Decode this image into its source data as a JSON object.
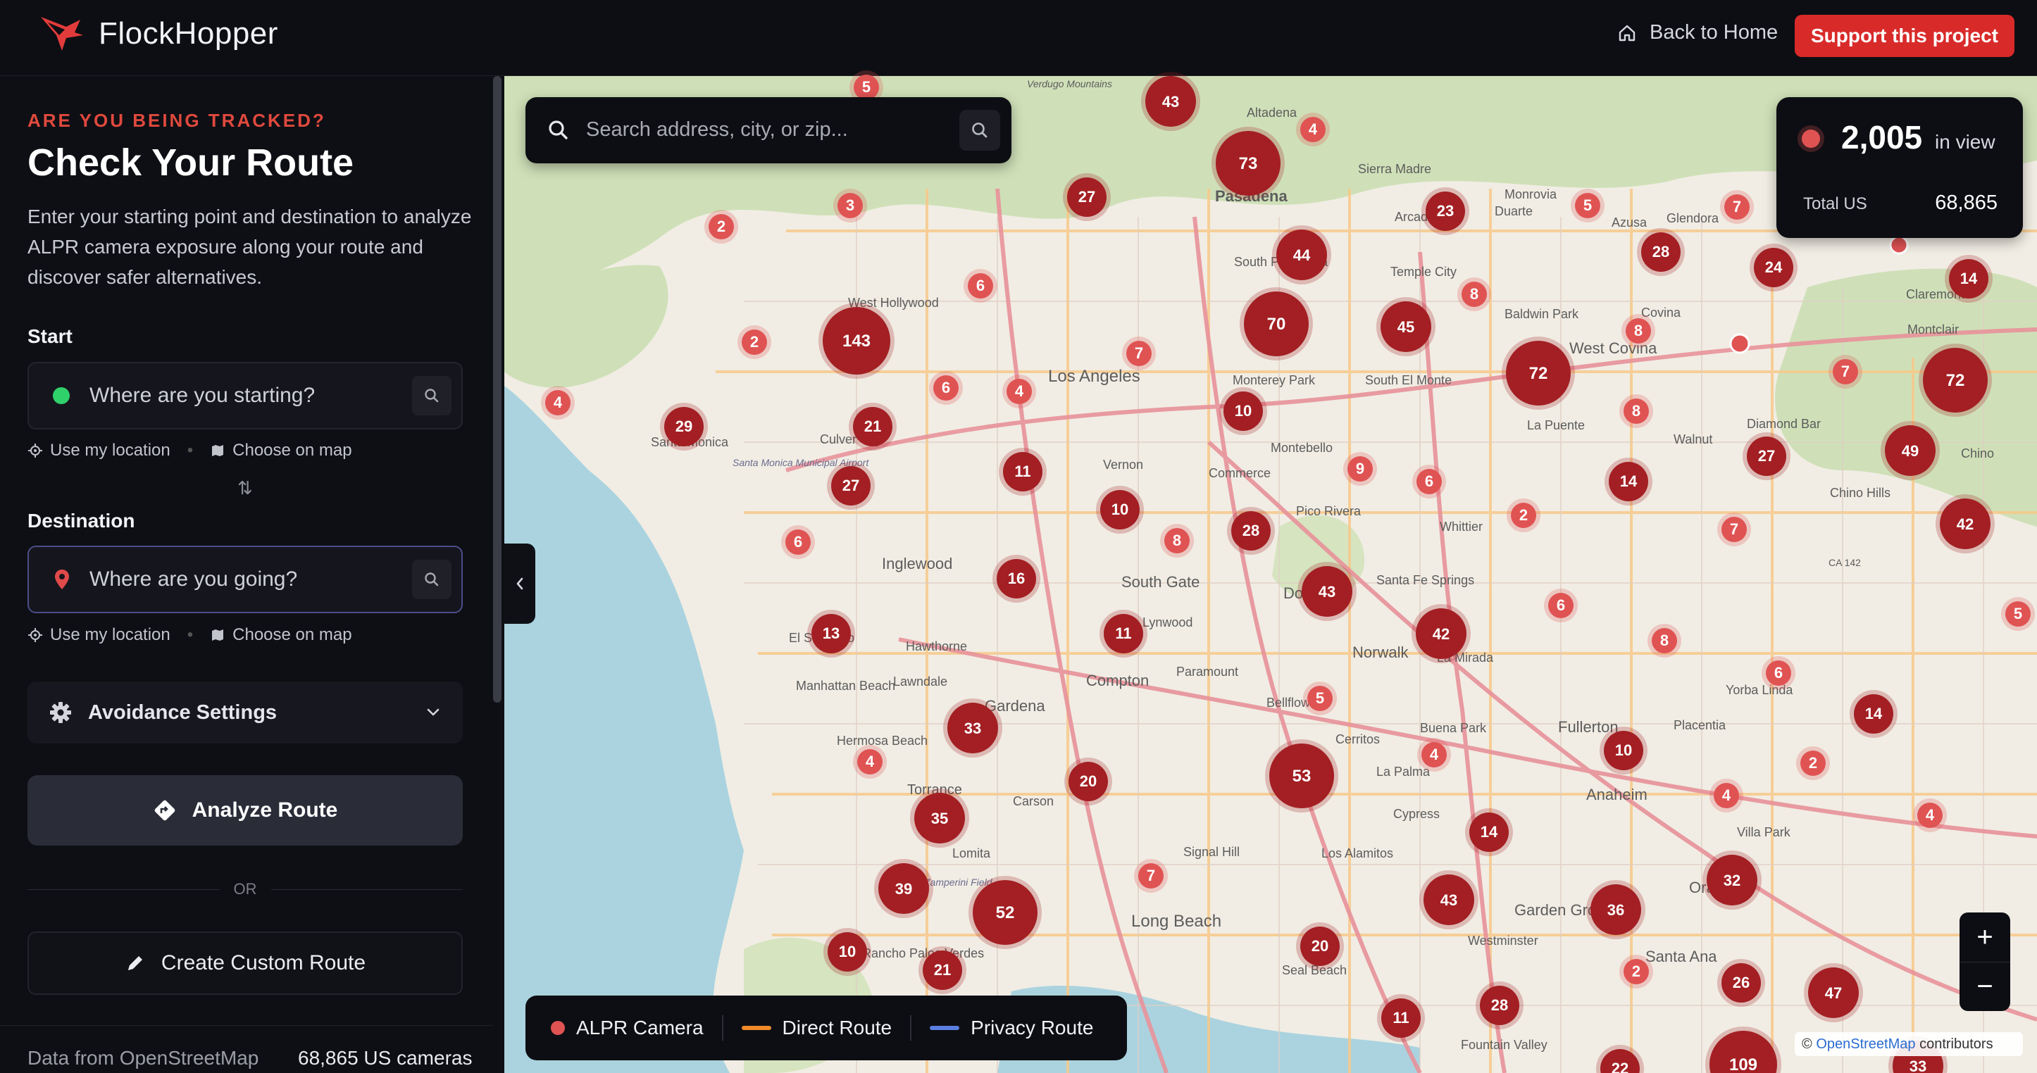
{
  "header": {
    "brand": "FlockHopper",
    "back_home": "Back to Home",
    "support": "Support this project"
  },
  "sidebar": {
    "eyebrow": "ARE YOU BEING TRACKED?",
    "title": "Check Your Route",
    "description": "Enter your starting point and destination to analyze ALPR camera exposure along your route and discover safer alternatives.",
    "start": {
      "label": "Start",
      "placeholder": "Where are you starting?",
      "use_location": "Use my location",
      "choose_map": "Choose on map"
    },
    "destination": {
      "label": "Destination",
      "placeholder": "Where are you going?",
      "use_location": "Use my location",
      "choose_map": "Choose on map"
    },
    "settings_label": "Avoidance Settings",
    "analyze_label": "Analyze Route",
    "or_label": "OR",
    "custom_label": "Create Custom Route",
    "footer": {
      "source": "Data from OpenStreetMap",
      "count": "68,865 US cameras"
    }
  },
  "map": {
    "search_placeholder": "Search address, city, or zip...",
    "stats": {
      "in_view_count": "2,005",
      "in_view_label": "in view",
      "total_label": "Total US",
      "total_value": "68,865"
    },
    "legend": {
      "camera": "ALPR Camera",
      "direct": "Direct Route",
      "privacy": "Privacy Route"
    },
    "colors": {
      "camera": "#e05353",
      "direct": "#f08a2a",
      "privacy": "#5b7fe0",
      "cluster": "#a31f23"
    },
    "zoom_in": "+",
    "zoom_out": "−",
    "attribution_prefix": "©",
    "attribution_link": "OpenStreetMap",
    "attribution_suffix": "contributors",
    "place_labels": [
      "Altadena",
      "Sierra Madre",
      "Pasadena",
      "Arcadia",
      "Duarte",
      "Azusa",
      "Glendora",
      "Monrovia",
      "South Pasadena",
      "Temple City",
      "West Hollywood",
      "Baldwin Park",
      "West Covina",
      "Covina",
      "Claremont",
      "Montclair",
      "Los Angeles",
      "Monterey Park",
      "South El Monte",
      "La Puente",
      "Diamond Bar",
      "Walnut",
      "Chino",
      "Chino Hills",
      "Santa Monica",
      "Culver City",
      "Montebello",
      "Commerce",
      "Vernon",
      "Pico Rivera",
      "Whittier",
      "Inglewood",
      "South Gate",
      "Downey",
      "Santa Fe Springs",
      "La Mirada",
      "Hawthorne",
      "Lynwood",
      "Norwalk",
      "El Segundo",
      "Manhattan Beach",
      "Lawndale",
      "Compton",
      "Paramount",
      "Bellflower",
      "Gardena",
      "Cerritos",
      "Buena Park",
      "Fullerton",
      "Placentia",
      "Yorba Linda",
      "Hermosa Beach",
      "Torrance",
      "Carson",
      "La Palma",
      "Anaheim",
      "Cypress",
      "Villa Park",
      "Lomita",
      "Signal Hill",
      "Los Alamitos",
      "Long Beach",
      "Garden Grove",
      "Orange",
      "Westminster",
      "Santa Ana",
      "Seal Beach",
      "Rancho Palos Verdes",
      "Fountain Valley",
      "Verdugo Mountains",
      "Santa Monica Municipal Airport",
      "Zamperini Field",
      "CA 142"
    ],
    "clusters": [
      {
        "count": "43"
      },
      {
        "count": "73"
      },
      {
        "count": "4"
      },
      {
        "count": "27"
      },
      {
        "count": "23"
      },
      {
        "count": "5"
      },
      {
        "count": "7"
      },
      {
        "count": "28"
      },
      {
        "count": "24"
      },
      {
        "count": "14"
      },
      {
        "count": "3"
      },
      {
        "count": "2"
      },
      {
        "count": "6"
      },
      {
        "count": "44"
      },
      {
        "count": "8"
      },
      {
        "count": "70"
      },
      {
        "count": "45"
      },
      {
        "count": "8"
      },
      {
        "count": "2"
      },
      {
        "count": "143"
      },
      {
        "count": "7"
      },
      {
        "count": "72"
      },
      {
        "count": "7"
      },
      {
        "count": "72"
      },
      {
        "count": "4"
      },
      {
        "count": "29"
      },
      {
        "count": "21"
      },
      {
        "count": "6"
      },
      {
        "count": "4"
      },
      {
        "count": "10"
      },
      {
        "count": "8"
      },
      {
        "count": "27"
      },
      {
        "count": "49"
      },
      {
        "count": "27"
      },
      {
        "count": "11"
      },
      {
        "count": "9"
      },
      {
        "count": "6"
      },
      {
        "count": "14"
      },
      {
        "count": "10"
      },
      {
        "count": "6"
      },
      {
        "count": "8"
      },
      {
        "count": "28"
      },
      {
        "count": "2"
      },
      {
        "count": "7"
      },
      {
        "count": "42"
      },
      {
        "count": "16"
      },
      {
        "count": "43"
      },
      {
        "count": "6"
      },
      {
        "count": "13"
      },
      {
        "count": "11"
      },
      {
        "count": "42"
      },
      {
        "count": "8"
      },
      {
        "count": "5"
      },
      {
        "count": "6"
      },
      {
        "count": "5"
      },
      {
        "count": "14"
      },
      {
        "count": "33"
      },
      {
        "count": "10"
      },
      {
        "count": "4"
      },
      {
        "count": "53"
      },
      {
        "count": "4"
      },
      {
        "count": "20"
      },
      {
        "count": "2"
      },
      {
        "count": "35"
      },
      {
        "count": "4"
      },
      {
        "count": "4"
      },
      {
        "count": "14"
      },
      {
        "count": "39"
      },
      {
        "count": "7"
      },
      {
        "count": "32"
      },
      {
        "count": "52"
      },
      {
        "count": "43"
      },
      {
        "count": "36"
      },
      {
        "count": "10"
      },
      {
        "count": "21"
      },
      {
        "count": "20"
      },
      {
        "count": "2"
      },
      {
        "count": "26"
      },
      {
        "count": "47"
      },
      {
        "count": "11"
      },
      {
        "count": "28"
      },
      {
        "count": "109"
      },
      {
        "count": "33"
      },
      {
        "count": "22"
      },
      {
        "count": "5"
      }
    ]
  }
}
